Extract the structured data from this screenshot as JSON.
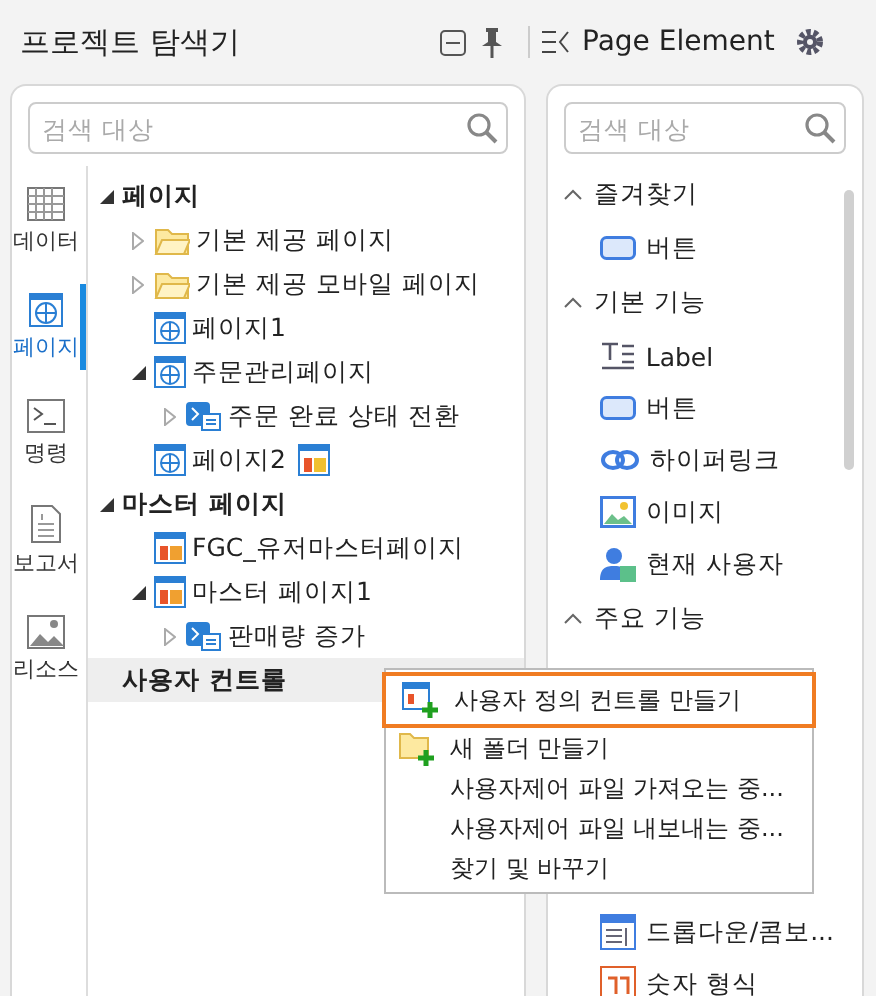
{
  "explorer": {
    "title": "프로젝트 탐색기",
    "search": {
      "placeholder": "검색 대상"
    },
    "side_tabs": [
      {
        "label": "데이터",
        "kind": "grid",
        "selected": false
      },
      {
        "label": "페이지",
        "kind": "globe",
        "selected": true
      },
      {
        "label": "명령",
        "kind": "terminal",
        "selected": false
      },
      {
        "label": "보고서",
        "kind": "report",
        "selected": false
      },
      {
        "label": "리소스",
        "kind": "image",
        "selected": false
      }
    ],
    "tree": [
      {
        "label": "페이지",
        "kind": "section",
        "expanded": true,
        "selected": false,
        "children": [
          {
            "label": "기본 제공 페이지",
            "kind": "folder",
            "expanded": false,
            "selected": false
          },
          {
            "label": "기본 제공 모바일 페이지",
            "kind": "folder",
            "expanded": false,
            "selected": false
          },
          {
            "label": "페이지1",
            "kind": "page",
            "selected": false
          },
          {
            "label": "주문관리페이지",
            "kind": "page",
            "expanded": true,
            "selected": false,
            "children": [
              {
                "label": "주문 완료 상태 전환",
                "kind": "action",
                "expanded": false,
                "selected": false
              }
            ]
          },
          {
            "label": "페이지2",
            "kind": "page",
            "badge": true,
            "selected": false
          }
        ]
      },
      {
        "label": "마스터 페이지",
        "kind": "section",
        "expanded": true,
        "selected": false,
        "children": [
          {
            "label": "FGC_유저마스터페이지",
            "kind": "master",
            "selected": false
          },
          {
            "label": "마스터 페이지1",
            "kind": "master",
            "expanded": true,
            "selected": false,
            "children": [
              {
                "label": "판매량 증가",
                "kind": "action",
                "expanded": false,
                "selected": false
              }
            ]
          }
        ]
      },
      {
        "label": "사용자 컨트롤",
        "kind": "section",
        "selected": true
      }
    ]
  },
  "elements": {
    "title": "Page Element",
    "search": {
      "placeholder": "검색 대상"
    },
    "groups": [
      {
        "label": "즐겨찾기",
        "expanded": true,
        "items": [
          {
            "label": "버튼",
            "kind": "button"
          }
        ]
      },
      {
        "label": "기본 기능",
        "expanded": true,
        "items": [
          {
            "label": "Label",
            "kind": "label"
          },
          {
            "label": "버튼",
            "kind": "button"
          },
          {
            "label": "하이퍼링크",
            "kind": "link"
          },
          {
            "label": "이미지",
            "kind": "image"
          },
          {
            "label": "현재 사용자",
            "kind": "user"
          }
        ]
      },
      {
        "label": "주요 기능",
        "expanded": true,
        "items": [
          {
            "label": "드롭다운/콤보...",
            "kind": "dropdown"
          },
          {
            "label": "숫자 형식",
            "kind": "number"
          }
        ]
      }
    ]
  },
  "context_menu": [
    {
      "label": "사용자 정의 컨트롤 만들기",
      "kind": "new-control",
      "selected": true
    },
    {
      "label": "새 폴더 만들기",
      "kind": "new-folder",
      "selected": false
    },
    {
      "label": "사용자제어 파일 가져오는 중...",
      "kind": "plain",
      "selected": false
    },
    {
      "label": "사용자제어 파일 내보내는 중...",
      "kind": "plain",
      "selected": false
    },
    {
      "label": "찾기 및 바꾸기",
      "kind": "plain",
      "selected": false
    }
  ]
}
